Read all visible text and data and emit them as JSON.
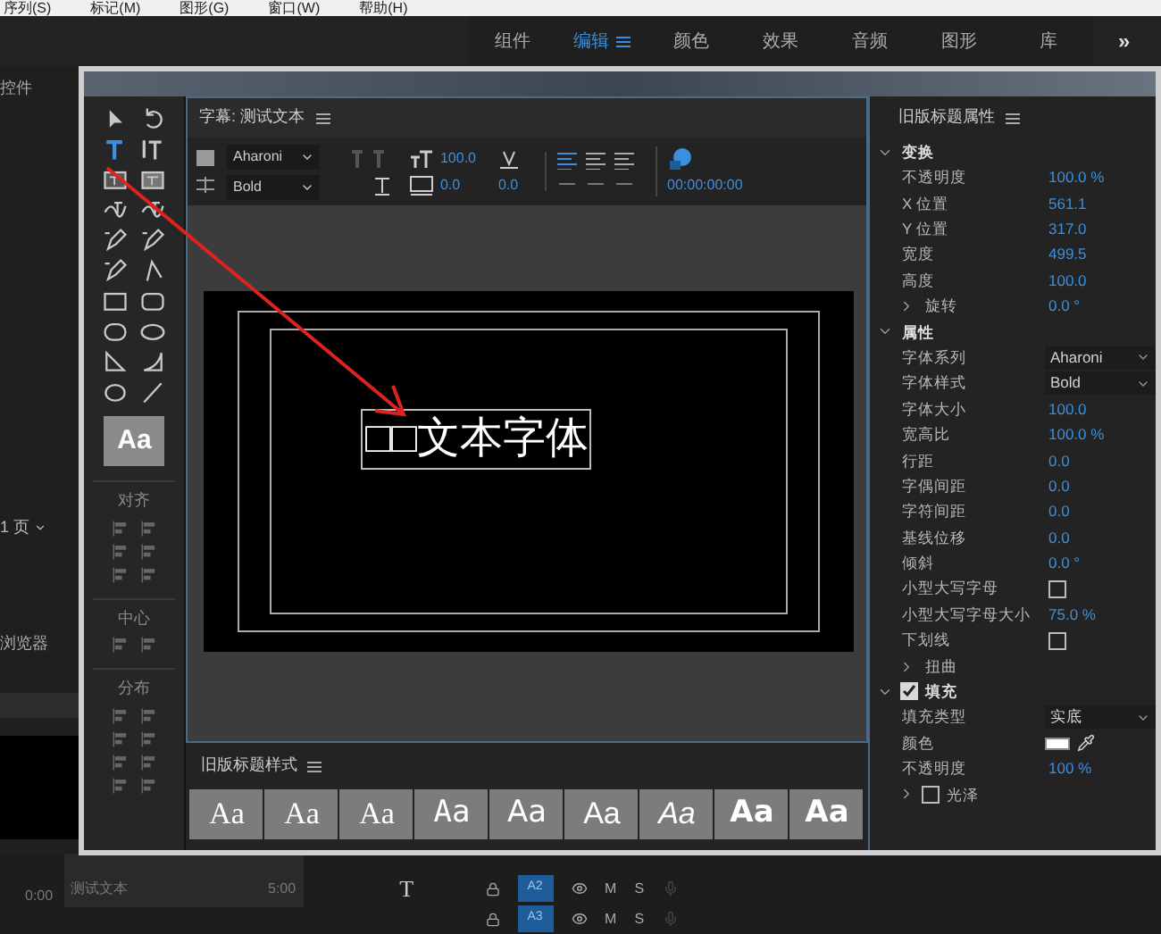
{
  "menu_bar": [
    "序列(S)",
    "标记(M)",
    "图形(G)",
    "窗口(W)",
    "帮助(H)"
  ],
  "workspaces": {
    "tabs": [
      {
        "label": "组件",
        "selected": false
      },
      {
        "label": "编辑",
        "selected": true
      },
      {
        "label": "颜色",
        "selected": false
      },
      {
        "label": "效果",
        "selected": false
      },
      {
        "label": "音频",
        "selected": false
      },
      {
        "label": "图形",
        "selected": false
      },
      {
        "label": "库",
        "selected": false
      }
    ],
    "overflow": "»"
  },
  "left_panel": {
    "title": "控件",
    "page": "1 页",
    "browser": "浏览器",
    "time_start": "0:00",
    "clip_name": "测试文本",
    "time_end": "5:00"
  },
  "tools": [
    {
      "kind": "select",
      "selected": false
    },
    {
      "kind": "rotate",
      "selected": false
    },
    {
      "kind": "type",
      "selected": true
    },
    {
      "kind": "vtype",
      "selected": false
    },
    {
      "kind": "area",
      "selected": false
    },
    {
      "kind": "varea",
      "selected": false
    },
    {
      "kind": "path",
      "selected": false
    },
    {
      "kind": "vpath",
      "selected": false
    },
    {
      "kind": "pen",
      "selected": false
    },
    {
      "kind": "pen",
      "selected": false
    },
    {
      "kind": "pen",
      "selected": false
    },
    {
      "kind": "corner",
      "selected": false
    },
    {
      "kind": "rect",
      "selected": false
    },
    {
      "kind": "rrect",
      "selected": false
    },
    {
      "kind": "pill",
      "selected": false
    },
    {
      "kind": "ellipse",
      "selected": false
    },
    {
      "kind": "wedge",
      "selected": false
    },
    {
      "kind": "arc",
      "selected": false
    },
    {
      "kind": "circle",
      "selected": false
    },
    {
      "kind": "line",
      "selected": false
    }
  ],
  "style_sample": "Aa",
  "align_sections": [
    {
      "label": "对齐"
    },
    {
      "label": "中心"
    },
    {
      "label": "分布"
    }
  ],
  "title_panel": {
    "title": "字幕: 测试文本",
    "font": "Aharoni",
    "style": "Bold",
    "size": "100.0",
    "kerning": "0.0",
    "tracking": "0.0",
    "timecode": "00:00:00:00",
    "text": "□□文本字体"
  },
  "styles_panel": {
    "title": "旧版标题样式",
    "swatches": [
      {
        "label": "Aa",
        "kind": "serif"
      },
      {
        "label": "Aa",
        "kind": "serif"
      },
      {
        "label": "Aa",
        "kind": "serif"
      },
      {
        "label": "Aa",
        "kind": "mono"
      },
      {
        "label": "Aa",
        "kind": "sans"
      },
      {
        "label": "Aa",
        "kind": "narrow"
      },
      {
        "label": "Aa",
        "kind": "italic"
      },
      {
        "label": "Aa",
        "kind": "bold"
      },
      {
        "label": "Aa",
        "kind": "heavy"
      }
    ]
  },
  "properties": {
    "title": "旧版标题属性",
    "rows": [
      {
        "kind": "section",
        "label": "变换",
        "expanded": true
      },
      {
        "kind": "value",
        "label": "不透明度",
        "value": "100.0 %"
      },
      {
        "kind": "value",
        "label": "X 位置",
        "value": "561.1"
      },
      {
        "kind": "value",
        "label": "Y 位置",
        "value": "317.0"
      },
      {
        "kind": "value",
        "label": "宽度",
        "value": "499.5"
      },
      {
        "kind": "value",
        "label": "高度",
        "value": "100.0"
      },
      {
        "kind": "sub",
        "label": "旋转",
        "value": "0.0 °",
        "expanded": false
      },
      {
        "kind": "section",
        "label": "属性",
        "expanded": true
      },
      {
        "kind": "dropdown",
        "label": "字体系列",
        "value": "Aharoni"
      },
      {
        "kind": "dropdown",
        "label": "字体样式",
        "value": "Bold"
      },
      {
        "kind": "value",
        "label": "字体大小",
        "value": "100.0"
      },
      {
        "kind": "value",
        "label": "宽高比",
        "value": "100.0 %"
      },
      {
        "kind": "value",
        "label": "行距",
        "value": "0.0"
      },
      {
        "kind": "value",
        "label": "字偶间距",
        "value": "0.0"
      },
      {
        "kind": "value",
        "label": "字符间距",
        "value": "0.0"
      },
      {
        "kind": "value",
        "label": "基线位移",
        "value": "0.0"
      },
      {
        "kind": "value",
        "label": "倾斜",
        "value": "0.0 °"
      },
      {
        "kind": "checkbox",
        "label": "小型大写字母",
        "checked": false
      },
      {
        "kind": "value",
        "label": "小型大写字母大小",
        "value": "75.0 %"
      },
      {
        "kind": "checkbox",
        "label": "下划线",
        "checked": false
      },
      {
        "kind": "sub",
        "label": "扭曲",
        "expanded": false
      },
      {
        "kind": "checksection",
        "label": "填充",
        "checked": true,
        "expanded": true
      },
      {
        "kind": "dropdown",
        "label": "填充类型",
        "value": "实底"
      },
      {
        "kind": "color",
        "label": "颜色",
        "color": "#ffffff"
      },
      {
        "kind": "value",
        "label": "不透明度",
        "value": "100 %"
      },
      {
        "kind": "checksub",
        "label": "光泽",
        "checked": false,
        "expanded": false
      }
    ]
  },
  "timeline": {
    "tool": "T",
    "tracks": [
      {
        "label": "A2",
        "mute": "M",
        "solo": "S"
      },
      {
        "label": "A3",
        "mute": "M",
        "solo": "S"
      }
    ]
  }
}
